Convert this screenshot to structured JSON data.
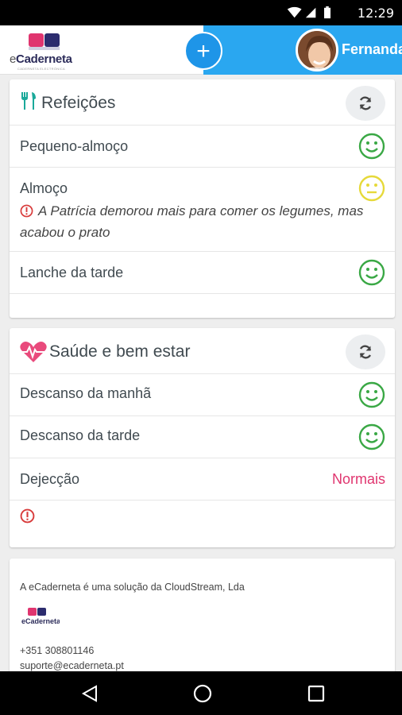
{
  "status_bar": {
    "time": "12:29"
  },
  "header": {
    "logo_text": "Caderneta",
    "logo_prefix": "e",
    "logo_subtitle": "CADERNETA ELECTRÓNICA",
    "add_label": "+",
    "user_name": "Fernanda"
  },
  "meals": {
    "title": "Refeições",
    "rows": [
      {
        "label": "Pequeno-almoço",
        "mood": "happy"
      },
      {
        "label": "Almoço",
        "mood": "neutral",
        "note": "A Patrícia demorou mais para comer os legumes, mas acabou o prato"
      },
      {
        "label": "Lanche da tarde",
        "mood": "happy"
      }
    ]
  },
  "health": {
    "title": "Saúde e bem estar",
    "rows": [
      {
        "label": "Descanso da manhã",
        "mood": "happy"
      },
      {
        "label": "Descanso da tarde",
        "mood": "happy"
      },
      {
        "label": "Dejecção",
        "value": "Normais"
      }
    ]
  },
  "footer": {
    "company_line": "A eCaderneta é uma solução da CloudStream, Lda",
    "phone": "+351 308801146",
    "email": "suporte@ecaderneta.pt"
  },
  "colors": {
    "accent_blue": "#2aa7f0",
    "happy_green": "#3aa845",
    "neutral_yellow": "#e6d93a",
    "teal_icon": "#1aa99a",
    "heart_pink": "#e94a7c",
    "warning_red": "#d83b3b",
    "value_pink": "#e0356f"
  }
}
